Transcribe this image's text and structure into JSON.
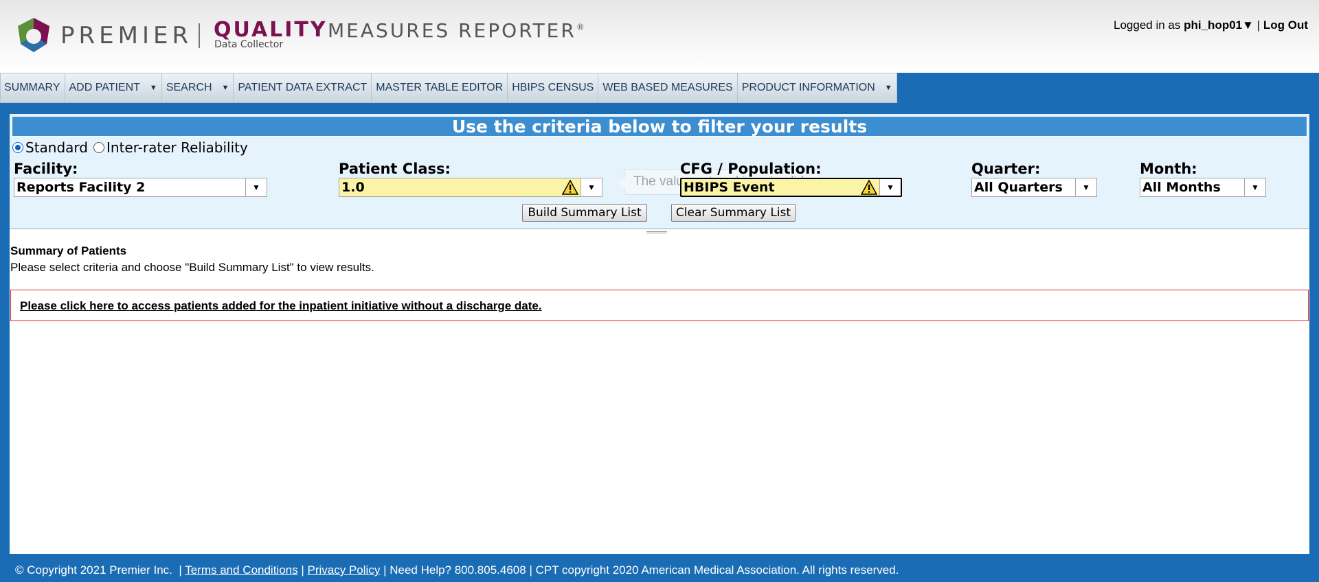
{
  "header": {
    "brand": "PREMIER",
    "product_primary": "QUALITY",
    "product_secondary": "MEASURES REPORTER",
    "product_reg": "®",
    "product_sub": "Data Collector",
    "logged_in_prefix": "Logged in as",
    "username": "phi_hop01",
    "user_caret": "▼",
    "separator": "|",
    "logout_label": "Log Out"
  },
  "nav": {
    "items": [
      {
        "label": "SUMMARY",
        "has_menu": false
      },
      {
        "label": "ADD PATIENT",
        "has_menu": true
      },
      {
        "label": "SEARCH",
        "has_menu": true
      },
      {
        "label": "PATIENT DATA EXTRACT",
        "has_menu": false
      },
      {
        "label": "MASTER TABLE EDITOR",
        "has_menu": false
      },
      {
        "label": "HBIPS CENSUS",
        "has_menu": false
      },
      {
        "label": "WEB BASED MEASURES",
        "has_menu": false
      },
      {
        "label": "PRODUCT INFORMATION",
        "has_menu": true
      }
    ],
    "caret": "▼"
  },
  "filter": {
    "title": "Use the criteria below to filter your results",
    "mode_options": [
      "Standard",
      "Inter-rater Reliability"
    ],
    "mode_selected": "Standard",
    "facility": {
      "label": "Facility:",
      "value": "Reports Facility 2"
    },
    "patient_class": {
      "label": "Patient Class:",
      "value": "1.0",
      "invalid": true
    },
    "cfg_population": {
      "label": "CFG / Population:",
      "value": "HBIPS Event",
      "invalid": true
    },
    "quarter": {
      "label": "Quarter:",
      "value": "All Quarters"
    },
    "month": {
      "label": "Month:",
      "value": "All Months"
    },
    "tooltip": "The value entered is not valid.",
    "build_button": "Build Summary List",
    "clear_button": "Clear Summary List",
    "dropdown_caret": "▼"
  },
  "summary": {
    "title": "Summary of Patients",
    "instructions": "Please select criteria and choose \"Build Summary List\" to view results.",
    "notice_link": "Please click here to access patients added for the inpatient initiative without a discharge date."
  },
  "footer": {
    "copyright": "© Copyright 2021 Premier Inc.",
    "sep": "|",
    "terms": "Terms and Conditions",
    "privacy": "Privacy Policy",
    "help": "Need Help? 800.805.4608",
    "cpt": "CPT copyright 2020 American Medical Association. All rights reserved."
  },
  "colors": {
    "page_background": "#1a6db4",
    "filter_title_bar": "#3c8ed0",
    "filter_panel": "#e5f3fc",
    "brand_quality": "#7c1150",
    "invalid_field": "#fbf4a6",
    "notice_border": "#e0202a"
  },
  "icons": {
    "logo": "premier-logo-mark",
    "warning": "warning-triangle-icon",
    "dropdown": "chevron-down-icon"
  }
}
